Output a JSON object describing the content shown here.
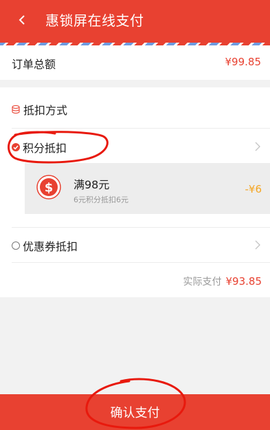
{
  "header": {
    "back_icon": "chevron-left-icon",
    "title": "惠锁屏在线支付",
    "color": "#e84131"
  },
  "order": {
    "label": "订单总额",
    "amount": "¥99.85"
  },
  "deduction": {
    "icon": "database-icon",
    "title": "抵扣方式",
    "options": [
      {
        "label": "积分抵扣",
        "selected": true,
        "detail": {
          "icon": "dollar-coin-icon",
          "title": "满98元",
          "subtitle": "6元积分抵扣6元",
          "discount": "-¥6"
        }
      },
      {
        "label": "优惠券抵扣",
        "selected": false
      }
    ]
  },
  "total": {
    "label": "实际支付",
    "value": "¥93.85"
  },
  "confirm": {
    "label": "确认支付"
  },
  "colors": {
    "accent": "#e84131",
    "discount": "#f5a623",
    "muted": "#999999"
  }
}
